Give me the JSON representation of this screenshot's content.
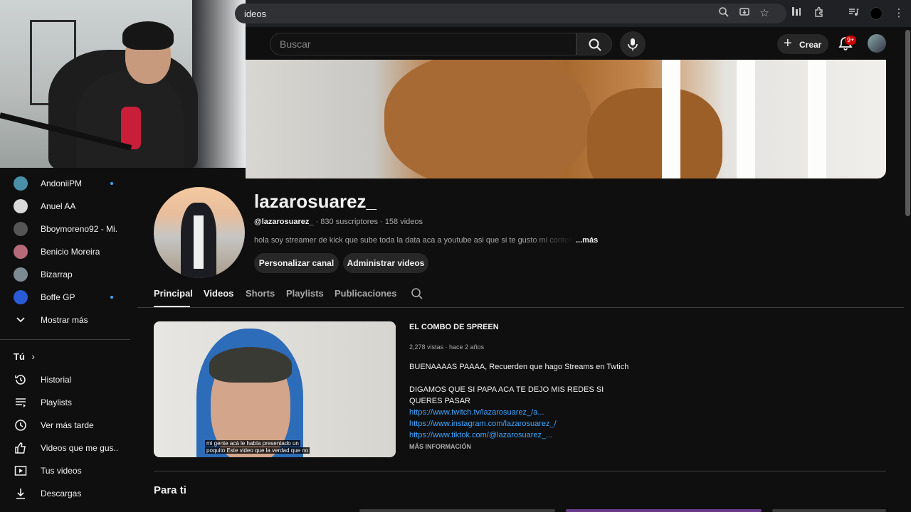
{
  "browser": {
    "url_fragment": "ideos"
  },
  "header": {
    "search_placeholder": "Buscar",
    "create_label": "Crear",
    "notifications_badge": "9+"
  },
  "sidebar": {
    "subscriptions": [
      {
        "name": "AndoniiPM",
        "live": true,
        "color": "#4a8fa8"
      },
      {
        "name": "Anuel AA",
        "live": false,
        "color": "#d9d9d9"
      },
      {
        "name": "Bboymoreno92 - Mi...",
        "live": false,
        "color": "#555555"
      },
      {
        "name": "Benicio Moreira",
        "live": false,
        "color": "#b56a7a"
      },
      {
        "name": "Bizarrap",
        "live": false,
        "color": "#7c8a93"
      },
      {
        "name": "Boffe GP",
        "live": true,
        "color": "#2a5bd7"
      }
    ],
    "show_more": "Mostrar más",
    "you_section": "Tú",
    "you_items": [
      {
        "label": "Historial",
        "icon": "history-icon"
      },
      {
        "label": "Playlists",
        "icon": "playlists-icon"
      },
      {
        "label": "Ver más tarde",
        "icon": "watch-later-icon"
      },
      {
        "label": "Videos que me gus...",
        "icon": "like-icon"
      },
      {
        "label": "Tus videos",
        "icon": "your-videos-icon"
      },
      {
        "label": "Descargas",
        "icon": "download-icon"
      }
    ]
  },
  "channel": {
    "name": "lazarosuarez_",
    "handle": "@lazarosuarez_",
    "subscribers": "830 suscriptores",
    "videos": "158 videos",
    "description": "hola soy streamer de kick que sube toda la data aca a youtube asi que si te gusto mi contenido",
    "more": "...más",
    "customize_button": "Personalizar canal",
    "manage_button": "Administrar videos"
  },
  "tabs": [
    {
      "label": "Principal",
      "active": true
    },
    {
      "label": "Videos",
      "active": false
    },
    {
      "label": "Shorts",
      "active": false
    },
    {
      "label": "Playlists",
      "active": false
    },
    {
      "label": "Publicaciones",
      "active": false
    }
  ],
  "featured": {
    "title": "EL COMBO DE SPREEN",
    "views": "2,278 vistas",
    "age": "hace 2 años",
    "line1": "BUENAAAAS PAAAA, Recuerden que hago Streams en Twtich",
    "line2": "DIGAMOS QUE SI PAPA ACA TE DEJO MIS REDES SI QUERES PASAR",
    "links": [
      "https://www.twitch.tv/lazarosuarez_/a...",
      "https://www.instagram.com/lazarosuarez_/",
      "https://www.tiktok.com/@lazarosuarez_..."
    ],
    "more_info": "MÁS INFORMACIÓN",
    "caption_line1": "mi gente acá le había presentado un",
    "caption_line2": "poquito Este video que la verdad que no"
  },
  "section": {
    "for_you": "Para ti"
  },
  "colors": {
    "background": "#0f0f0f",
    "link": "#3ea6ff",
    "accent_red": "#ff0033"
  }
}
